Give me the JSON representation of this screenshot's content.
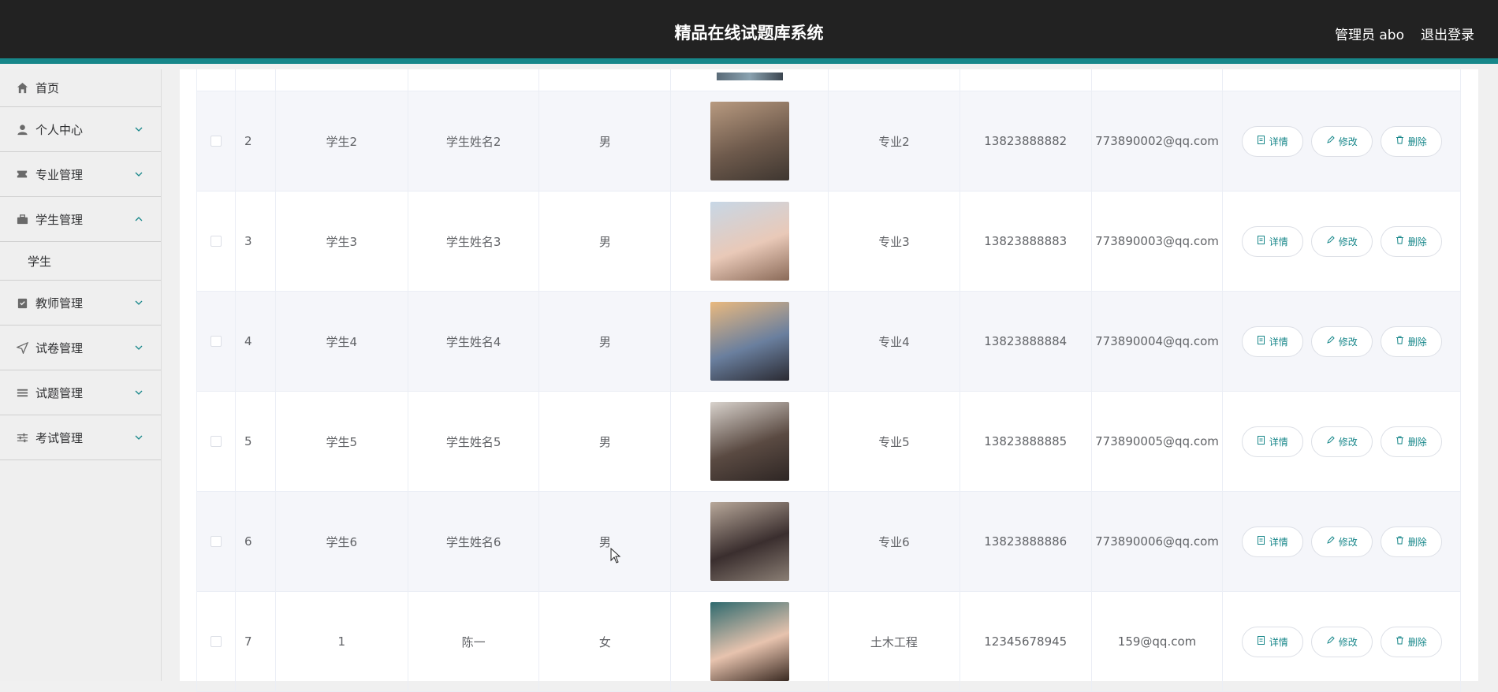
{
  "header": {
    "title": "精品在线试题库系统",
    "user": "管理员 abo",
    "logout": "退出登录"
  },
  "sidebar": {
    "items": [
      {
        "label": "首页",
        "icon": "home-icon"
      },
      {
        "label": "个人中心",
        "icon": "user-icon"
      },
      {
        "label": "专业管理",
        "icon": "ticket-icon"
      },
      {
        "label": "学生管理",
        "icon": "briefcase-icon",
        "expanded": true,
        "sub": [
          "学生"
        ]
      },
      {
        "label": "教师管理",
        "icon": "clipboard-icon"
      },
      {
        "label": "试卷管理",
        "icon": "send-icon"
      },
      {
        "label": "试题管理",
        "icon": "list-icon"
      },
      {
        "label": "考试管理",
        "icon": "sliders-icon"
      }
    ]
  },
  "table": {
    "rows": [
      {
        "index": "2",
        "number": "学生2",
        "name": "学生姓名2",
        "sex": "男",
        "major": "专业2",
        "phone": "13823888882",
        "email": "773890002@qq.com"
      },
      {
        "index": "3",
        "number": "学生3",
        "name": "学生姓名3",
        "sex": "男",
        "major": "专业3",
        "phone": "13823888883",
        "email": "773890003@qq.com"
      },
      {
        "index": "4",
        "number": "学生4",
        "name": "学生姓名4",
        "sex": "男",
        "major": "专业4",
        "phone": "13823888884",
        "email": "773890004@qq.com"
      },
      {
        "index": "5",
        "number": "学生5",
        "name": "学生姓名5",
        "sex": "男",
        "major": "专业5",
        "phone": "13823888885",
        "email": "773890005@qq.com"
      },
      {
        "index": "6",
        "number": "学生6",
        "name": "学生姓名6",
        "sex": "男",
        "major": "专业6",
        "phone": "13823888886",
        "email": "773890006@qq.com"
      },
      {
        "index": "7",
        "number": "1",
        "name": "陈一",
        "sex": "女",
        "major": "土木工程",
        "phone": "12345678945",
        "email": "159@qq.com"
      }
    ],
    "actions": {
      "detail": "详情",
      "edit": "修改",
      "delete": "删除"
    }
  },
  "colors": {
    "accent": "#17878a",
    "header_bg": "#222222"
  }
}
